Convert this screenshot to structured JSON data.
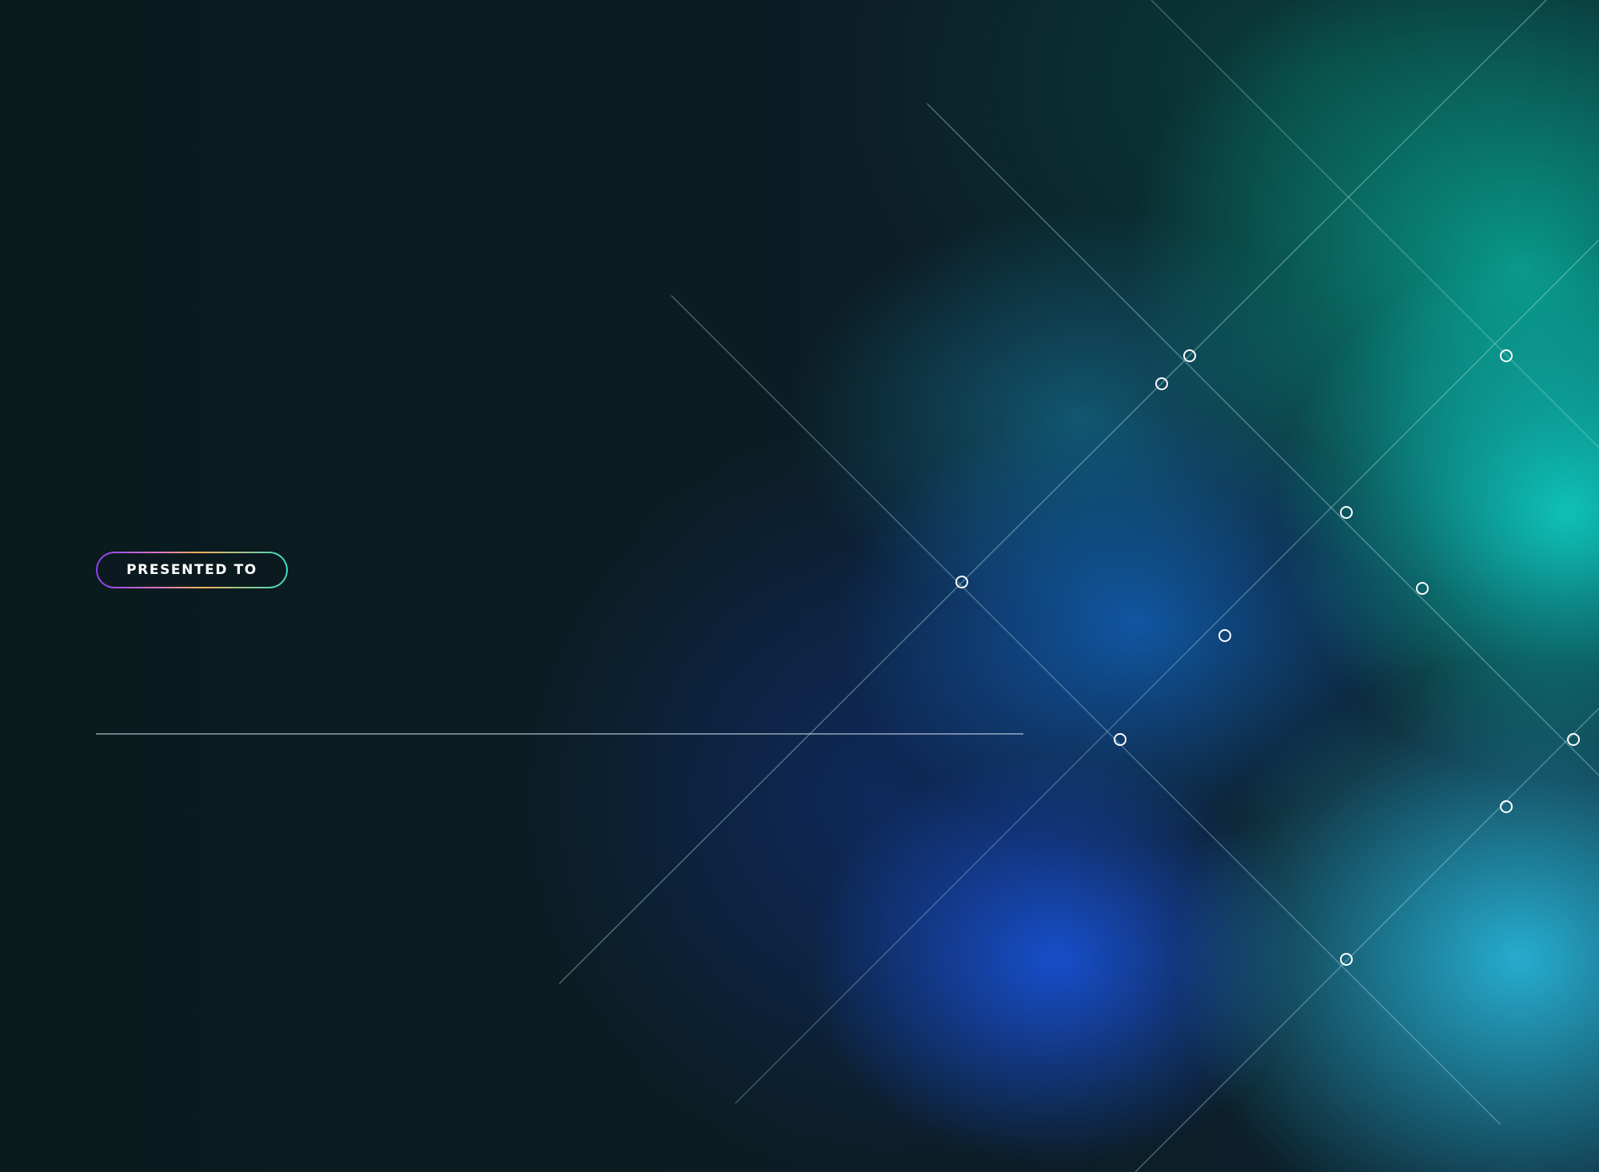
{
  "badge": {
    "label": "PRESENTED TO"
  },
  "colors": {
    "background": "#0a1a1e",
    "teal_accent": "#0ec8be",
    "blue_accent": "#1850d2",
    "badge_gradient": [
      "#8a3ff0",
      "#e07ac0",
      "#f4b25c",
      "#3fd6c6"
    ]
  }
}
